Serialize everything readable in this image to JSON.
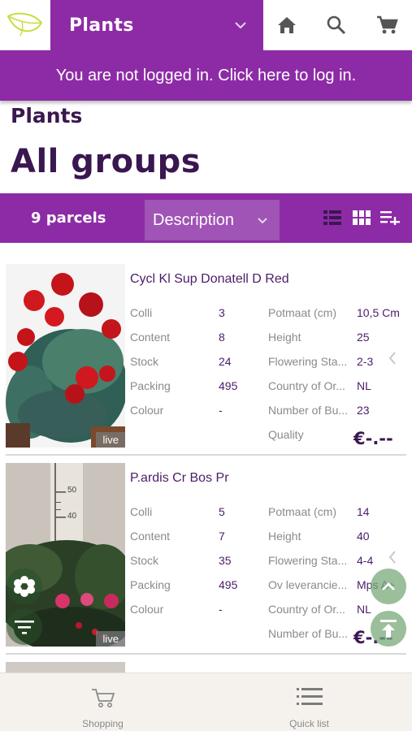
{
  "header": {
    "category_label": "Plants",
    "icons": [
      "logo-leaf",
      "chevron-down-icon",
      "home-icon",
      "search-icon",
      "cart-icon"
    ]
  },
  "login_banner": {
    "text": "You are not logged in. Click here to log in."
  },
  "breadcrumb": "Plants",
  "page_title": "All groups",
  "toolbar": {
    "parcels": "9 parcels",
    "sort_label": "Description",
    "icons": [
      "list-view-icon",
      "grid-view-icon",
      "add-to-list-icon"
    ]
  },
  "products": [
    {
      "name": "Cycl Kl Sup Donatell D Red",
      "live": "live",
      "left_attrs": [
        {
          "label": "Colli",
          "value": "3"
        },
        {
          "label": "Content",
          "value": "8"
        },
        {
          "label": "Stock",
          "value": "24"
        },
        {
          "label": "Packing",
          "value": "495"
        },
        {
          "label": "Colour",
          "value": "-"
        }
      ],
      "right_attrs": [
        {
          "label": "Potmaat (cm)",
          "value": "10,5 Cm"
        },
        {
          "label": "Height",
          "value": "25"
        },
        {
          "label": "Flowering Sta...",
          "value": "2-3"
        },
        {
          "label": "Country of Or...",
          "value": "NL"
        },
        {
          "label": "Number of Bu...",
          "value": "23"
        },
        {
          "label": "Quality",
          "value": ""
        }
      ],
      "price": "€-.--"
    },
    {
      "name": "P.ardis Cr Bos Pr",
      "live": "live",
      "left_attrs": [
        {
          "label": "Colli",
          "value": "5"
        },
        {
          "label": "Content",
          "value": "7"
        },
        {
          "label": "Stock",
          "value": "35"
        },
        {
          "label": "Packing",
          "value": "495"
        },
        {
          "label": "Colour",
          "value": "-"
        }
      ],
      "right_attrs": [
        {
          "label": "Potmaat (cm)",
          "value": "14"
        },
        {
          "label": "Height",
          "value": "40"
        },
        {
          "label": "Flowering Sta...",
          "value": "4-4"
        },
        {
          "label": "Ov leverancie...",
          "value": "Mps A+"
        },
        {
          "label": "Country of Or...",
          "value": "NL"
        },
        {
          "label": "Number of Bu...",
          "value": ""
        }
      ],
      "price": "€-.--",
      "ruler_marks": [
        "50",
        "40"
      ]
    }
  ],
  "bottom_nav": [
    {
      "label": "Shopping",
      "icon": "shopping-cart-icon"
    },
    {
      "label": "Quick list",
      "icon": "quick-list-icon"
    }
  ],
  "colors": {
    "brand_purple": "#8d2ba6",
    "text_dark": "#3a1750",
    "leaf_logo": "#c8dd3c"
  }
}
